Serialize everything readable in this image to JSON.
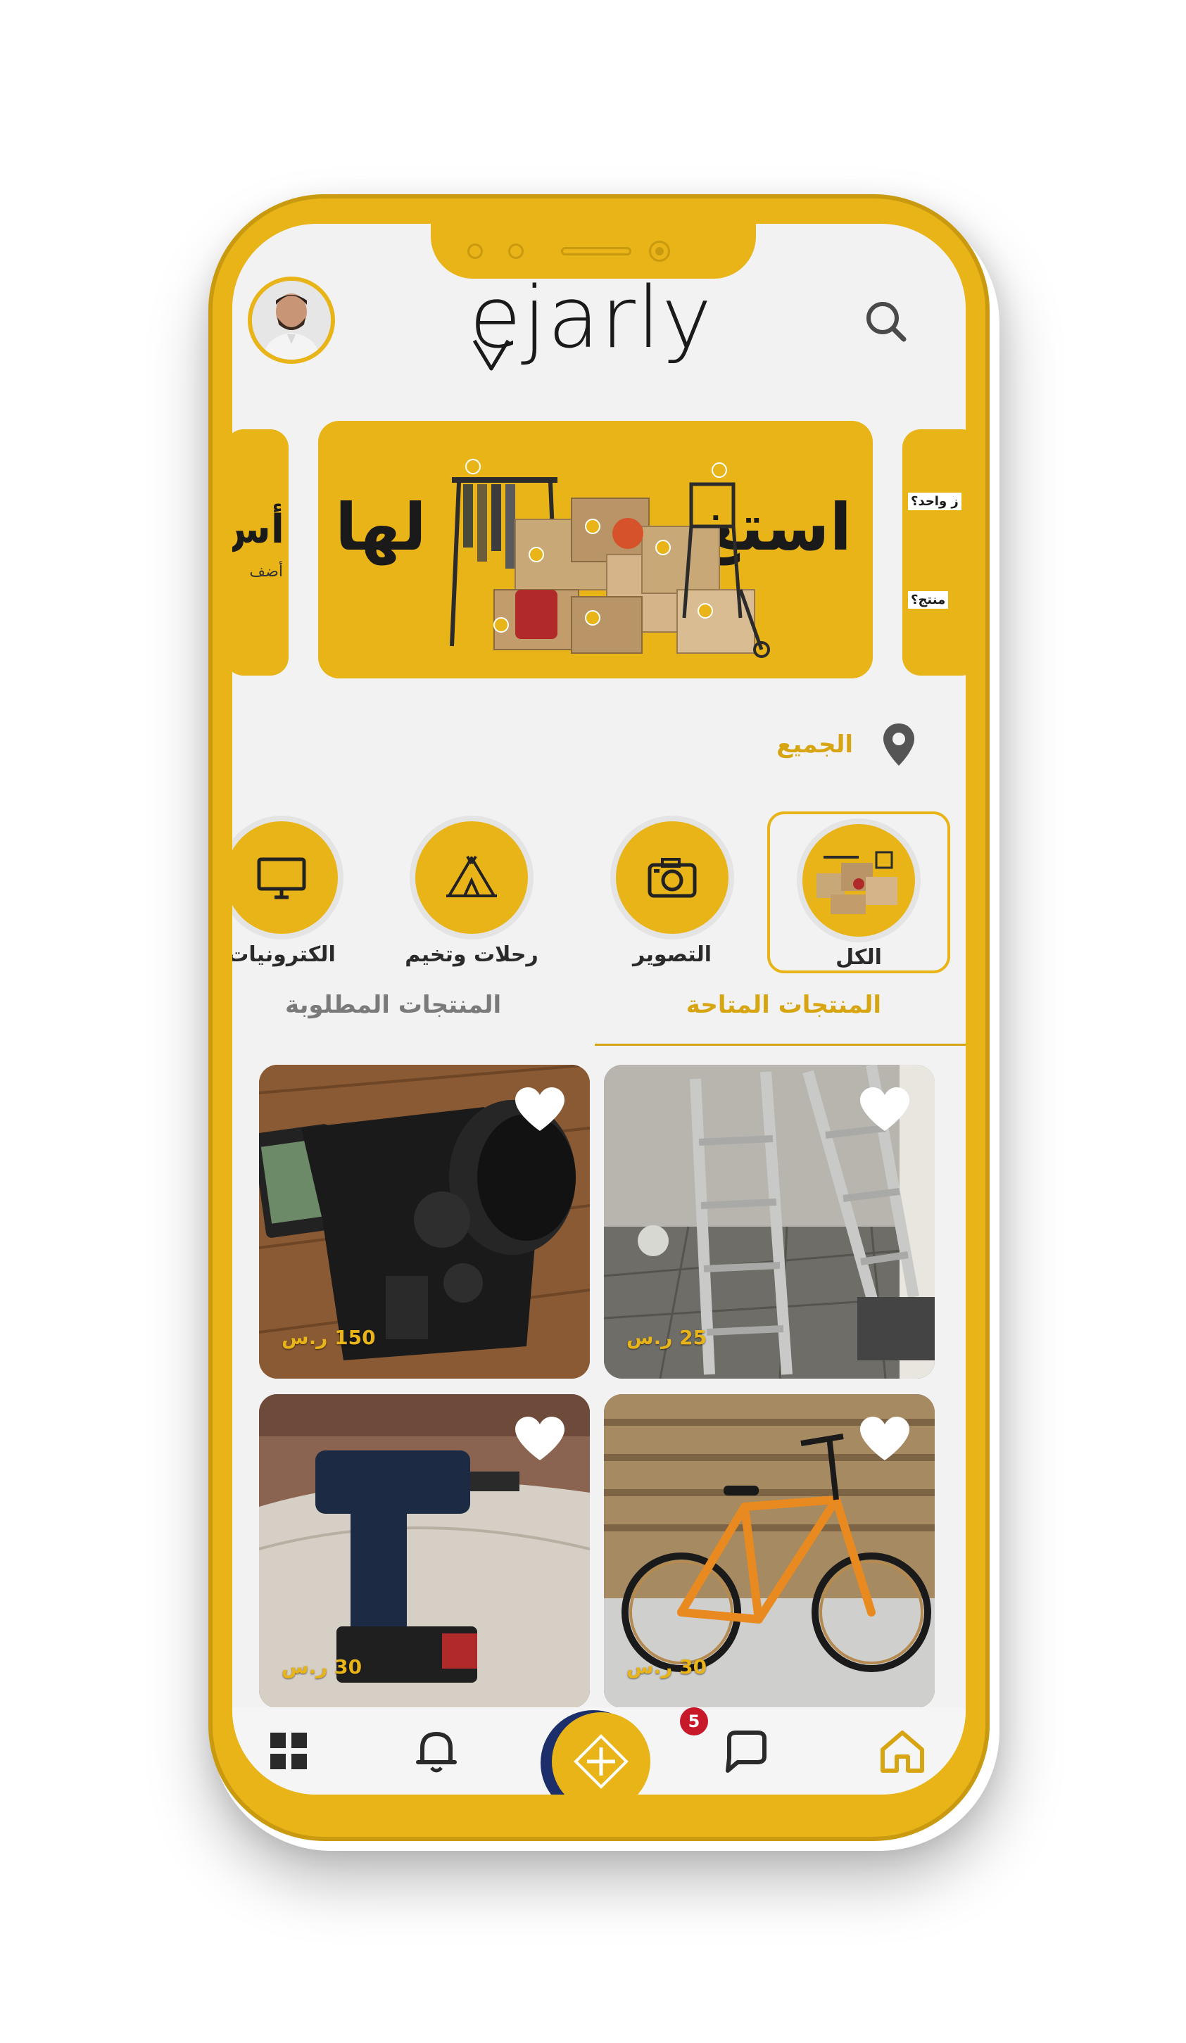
{
  "app": {
    "logo_text": "ejarly"
  },
  "header": {
    "search_icon": "search-icon",
    "avatar": "user-avatar"
  },
  "banner": {
    "title_right": "استغ",
    "title_left": "لها",
    "side_left_title": "أس",
    "side_left_sub": "أضف",
    "side_right_line1": "ز واحد؟",
    "side_right_line2": "منتج؟"
  },
  "location": {
    "label": "الجميع",
    "icon": "location-pin-icon"
  },
  "categories": [
    {
      "label": "الكل",
      "icon": "boxes-image",
      "selected": true
    },
    {
      "label": "التصوير",
      "icon": "camera-icon",
      "selected": false
    },
    {
      "label": "رحلات وتخيم",
      "icon": "tent-icon",
      "selected": false
    },
    {
      "label": "الكترونيات",
      "icon": "monitor-icon",
      "selected": false
    }
  ],
  "tabs": {
    "available": "المنتجات المتاحة",
    "requested": "المنتجات المطلوبة"
  },
  "products": [
    {
      "name": "ladder",
      "price": "25 ر.س"
    },
    {
      "name": "camera",
      "price": "150 ر.س"
    },
    {
      "name": "bicycle",
      "price": "30 ر.س"
    },
    {
      "name": "drill",
      "price": "30 ر.س"
    }
  ],
  "nav": {
    "home": "home-icon",
    "chat": "chat-icon",
    "chat_badge": "5",
    "add": "add-icon",
    "notifications": "bell-icon",
    "menu": "grid-icon"
  },
  "colors": {
    "accent": "#e9b418",
    "accent_text": "#d8a512",
    "badge": "#c8192a"
  }
}
